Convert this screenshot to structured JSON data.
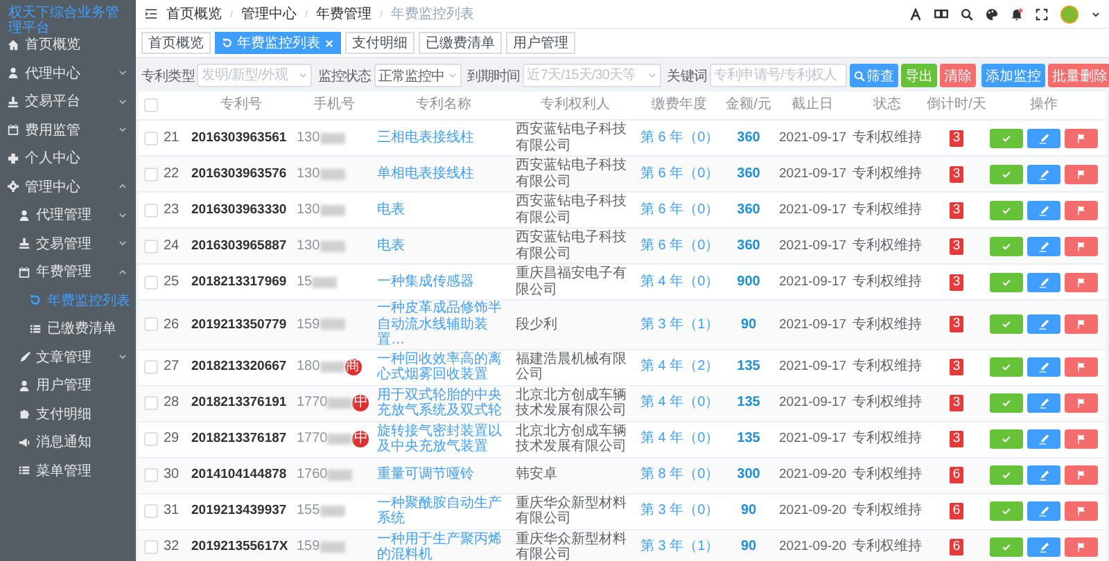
{
  "sidebar": {
    "title": "权天下综合业务管理平台",
    "items": [
      {
        "label": "首页概览",
        "selected": false
      },
      {
        "label": "代理中心",
        "selected": false,
        "expanded": false
      },
      {
        "label": "交易平台",
        "selected": false,
        "expanded": false
      },
      {
        "label": "费用监管",
        "selected": false,
        "expanded": false
      },
      {
        "label": "个人中心",
        "selected": false
      },
      {
        "label": "管理中心",
        "selected": false,
        "expanded": true,
        "children": [
          {
            "label": "代理管理",
            "selected": false,
            "expanded": false
          },
          {
            "label": "交易管理",
            "selected": false,
            "expanded": false
          },
          {
            "label": "年费管理",
            "selected": false,
            "expanded": true,
            "children": [
              {
                "label": "年费监控列表",
                "selected": true
              },
              {
                "label": "已缴费清单",
                "selected": false
              }
            ]
          },
          {
            "label": "文章管理",
            "selected": false,
            "expanded": false
          },
          {
            "label": "用户管理",
            "selected": false
          },
          {
            "label": "支付明细",
            "selected": false
          },
          {
            "label": "消息通知",
            "selected": false
          },
          {
            "label": "菜单管理",
            "selected": false
          }
        ]
      }
    ]
  },
  "breadcrumb": [
    "首页概览",
    "管理中心",
    "年费管理",
    "年费监控列表"
  ],
  "tabs": [
    {
      "label": "首页概览",
      "selected": false
    },
    {
      "label": "年费监控列表",
      "selected": true
    },
    {
      "label": "支付明细",
      "selected": false
    },
    {
      "label": "已缴费清单",
      "selected": false
    },
    {
      "label": "用户管理",
      "selected": false
    }
  ],
  "filters": [
    {
      "kind": "select",
      "label": "专利类型",
      "placeholder": "发明/新型/外观"
    },
    {
      "kind": "select",
      "label": "监控状态",
      "value": "正常监控中"
    },
    {
      "kind": "select",
      "label": "到期时间",
      "placeholder": "近7天/15天/30天等"
    },
    {
      "kind": "input",
      "label": "关键词",
      "placeholder": "专利申请号/专利权人"
    }
  ],
  "buttons": [
    {
      "kind": "search",
      "label": "筛查"
    },
    {
      "kind": "export",
      "label": "导出"
    },
    {
      "kind": "clear",
      "label": "清除"
    },
    {
      "kind": "add",
      "label": "添加监控"
    },
    {
      "kind": "batch-delete",
      "label": "批量删除"
    }
  ],
  "table": {
    "header_checked": false,
    "columns": [
      "专利号",
      "手机号",
      "专利名称",
      "专利权利人",
      "缴费年度",
      "金额/元",
      "截止日",
      "状态",
      "倒计时/天",
      "操作"
    ],
    "rows": [
      {
        "checked": false,
        "index": "21",
        "patent_no": "2016303963561",
        "phone": "130",
        "name": "三相电表接线柱",
        "owner": "西安蓝钻电子科技有限公司",
        "fee_year": "第 6 年（0）",
        "amount": "360",
        "due_date": "2021-09-17",
        "status": "专利权维持",
        "countdown": "3"
      },
      {
        "checked": false,
        "index": "22",
        "patent_no": "2016303963576",
        "phone": "130",
        "name": "单相电表接线柱",
        "owner": "西安蓝钻电子科技有限公司",
        "fee_year": "第 6 年（0）",
        "amount": "360",
        "due_date": "2021-09-17",
        "status": "专利权维持",
        "countdown": "3"
      },
      {
        "checked": false,
        "index": "23",
        "patent_no": "2016303963330",
        "phone": "130",
        "name": "电表",
        "owner": "西安蓝钻电子科技有限公司",
        "fee_year": "第 6 年（0）",
        "amount": "360",
        "due_date": "2021-09-17",
        "status": "专利权维持",
        "countdown": "3"
      },
      {
        "checked": false,
        "index": "24",
        "patent_no": "2016303965887",
        "phone": "130",
        "name": "电表",
        "owner": "西安蓝钻电子科技有限公司",
        "fee_year": "第 6 年（0）",
        "amount": "360",
        "due_date": "2021-09-17",
        "status": "专利权维持",
        "countdown": "3"
      },
      {
        "checked": false,
        "index": "25",
        "patent_no": "2018213317969",
        "phone": "15",
        "name": "一种集成传感器",
        "owner": "重庆昌福安电子有限公司",
        "fee_year": "第 4 年（0）",
        "amount": "900",
        "due_date": "2021-09-17",
        "status": "专利权维持",
        "countdown": "3"
      },
      {
        "checked": false,
        "index": "26",
        "patent_no": "2019213350779",
        "phone": "159",
        "name": "一种皮革成品修饰半自动流水线辅助装置…",
        "owner": "段少利",
        "fee_year": "第 3 年（1）",
        "amount": "90",
        "due_date": "2021-09-17",
        "status": "专利权维持",
        "countdown": "3"
      },
      {
        "checked": false,
        "index": "27",
        "patent_no": "2018213320667",
        "phone": "180",
        "badge": "商",
        "name": "一种回收效率高的离心式烟雾回收装置",
        "owner": "福建浩晨机械有限公司",
        "fee_year": "第 4 年（2）",
        "amount": "135",
        "due_date": "2021-09-17",
        "status": "专利权维持",
        "countdown": "3"
      },
      {
        "checked": false,
        "index": "28",
        "patent_no": "2018213376191",
        "phone": "1770",
        "badge": "中",
        "name": "用于双式轮胎的中央充放气系统及双式轮",
        "owner": "北京北方创成车辆技术发展有限公司",
        "fee_year": "第 4 年（0）",
        "amount": "135",
        "due_date": "2021-09-17",
        "status": "专利权维持",
        "countdown": "3"
      },
      {
        "checked": false,
        "index": "29",
        "patent_no": "2018213376187",
        "phone": "1770",
        "badge": "中",
        "name": "旋转接气密封装置以及中央充放气装置",
        "owner": "北京北方创成车辆技术发展有限公司",
        "fee_year": "第 4 年（0）",
        "amount": "135",
        "due_date": "2021-09-17",
        "status": "专利权维持",
        "countdown": "3"
      },
      {
        "checked": false,
        "index": "30",
        "patent_no": "2014104144878",
        "phone": "1760",
        "name": "重量可调节哑铃",
        "owner": "韩安卓",
        "fee_year": "第 8 年（0）",
        "amount": "300",
        "due_date": "2021-09-20",
        "status": "专利权维持",
        "countdown": "6"
      },
      {
        "checked": false,
        "index": "31",
        "patent_no": "2019213439937",
        "phone": "155",
        "name": "一种聚酰胺自动生产系统",
        "owner": "重庆华众新型材料有限公司",
        "fee_year": "第 3 年（0）",
        "amount": "90",
        "due_date": "2021-09-20",
        "status": "专利权维持",
        "countdown": "6"
      },
      {
        "checked": false,
        "index": "32",
        "patent_no": "201921355617X",
        "phone": "159",
        "name": "一种用于生产聚丙烯的混料机",
        "owner": "重庆华众新型材料有限公司",
        "fee_year": "第 3 年（1）",
        "amount": "90",
        "due_date": "2021-09-20",
        "status": "专利权维持",
        "countdown": "6"
      }
    ]
  }
}
